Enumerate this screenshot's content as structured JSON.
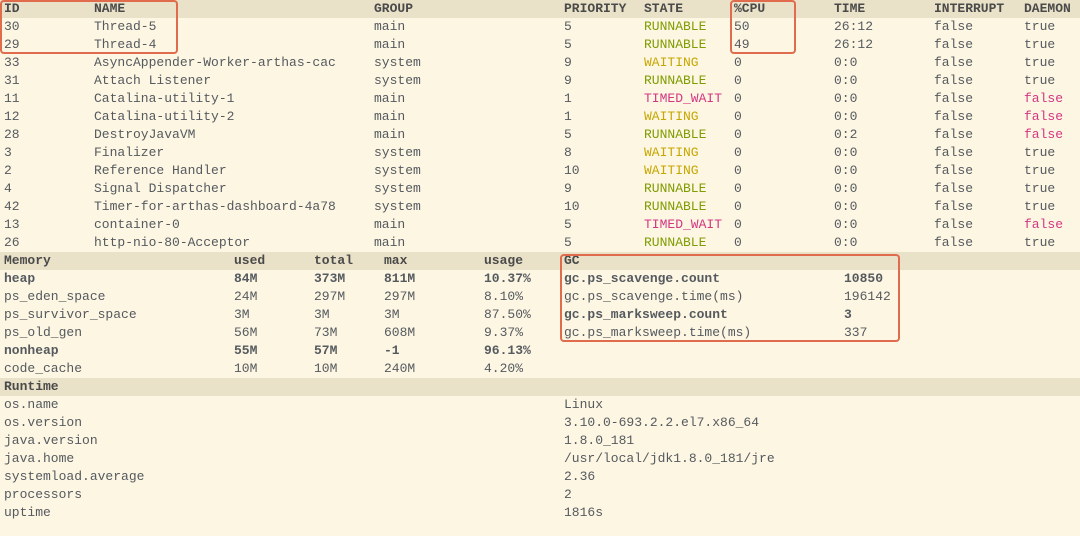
{
  "threads": {
    "headers": {
      "id": "ID",
      "name": "NAME",
      "group": "GROUP",
      "priority": "PRIORITY",
      "state": "STATE",
      "cpu": "%CPU",
      "time": "TIME",
      "interrupt": "INTERRUPT",
      "daemon": "DAEMON"
    },
    "rows": [
      {
        "id": "30",
        "name": "Thread-5",
        "group": "main",
        "priority": "5",
        "state": "RUNNABLE",
        "state_cls": "green",
        "cpu": "50",
        "time": "26:12",
        "interrupt": "false",
        "daemon": "true",
        "daemon_cls": ""
      },
      {
        "id": "29",
        "name": "Thread-4",
        "group": "main",
        "priority": "5",
        "state": "RUNNABLE",
        "state_cls": "green",
        "cpu": "49",
        "time": "26:12",
        "interrupt": "false",
        "daemon": "true",
        "daemon_cls": ""
      },
      {
        "id": "33",
        "name": "AsyncAppender-Worker-arthas-cac",
        "group": "system",
        "priority": "9",
        "state": "WAITING",
        "state_cls": "yellow",
        "cpu": "0",
        "time": "0:0",
        "interrupt": "false",
        "daemon": "true",
        "daemon_cls": ""
      },
      {
        "id": "31",
        "name": "Attach Listener",
        "group": "system",
        "priority": "9",
        "state": "RUNNABLE",
        "state_cls": "green",
        "cpu": "0",
        "time": "0:0",
        "interrupt": "false",
        "daemon": "true",
        "daemon_cls": ""
      },
      {
        "id": "11",
        "name": "Catalina-utility-1",
        "group": "main",
        "priority": "1",
        "state": "TIMED_WAIT",
        "state_cls": "pink",
        "cpu": "0",
        "time": "0:0",
        "interrupt": "false",
        "daemon": "false",
        "daemon_cls": "redf"
      },
      {
        "id": "12",
        "name": "Catalina-utility-2",
        "group": "main",
        "priority": "1",
        "state": "WAITING",
        "state_cls": "yellow",
        "cpu": "0",
        "time": "0:0",
        "interrupt": "false",
        "daemon": "false",
        "daemon_cls": "redf"
      },
      {
        "id": "28",
        "name": "DestroyJavaVM",
        "group": "main",
        "priority": "5",
        "state": "RUNNABLE",
        "state_cls": "green",
        "cpu": "0",
        "time": "0:2",
        "interrupt": "false",
        "daemon": "false",
        "daemon_cls": "redf"
      },
      {
        "id": "3",
        "name": "Finalizer",
        "group": "system",
        "priority": "8",
        "state": "WAITING",
        "state_cls": "yellow",
        "cpu": "0",
        "time": "0:0",
        "interrupt": "false",
        "daemon": "true",
        "daemon_cls": ""
      },
      {
        "id": "2",
        "name": "Reference Handler",
        "group": "system",
        "priority": "10",
        "state": "WAITING",
        "state_cls": "yellow",
        "cpu": "0",
        "time": "0:0",
        "interrupt": "false",
        "daemon": "true",
        "daemon_cls": ""
      },
      {
        "id": "4",
        "name": "Signal Dispatcher",
        "group": "system",
        "priority": "9",
        "state": "RUNNABLE",
        "state_cls": "green",
        "cpu": "0",
        "time": "0:0",
        "interrupt": "false",
        "daemon": "true",
        "daemon_cls": ""
      },
      {
        "id": "42",
        "name": "Timer-for-arthas-dashboard-4a78",
        "group": "system",
        "priority": "10",
        "state": "RUNNABLE",
        "state_cls": "green",
        "cpu": "0",
        "time": "0:0",
        "interrupt": "false",
        "daemon": "true",
        "daemon_cls": ""
      },
      {
        "id": "13",
        "name": "container-0",
        "group": "main",
        "priority": "5",
        "state": "TIMED_WAIT",
        "state_cls": "pink",
        "cpu": "0",
        "time": "0:0",
        "interrupt": "false",
        "daemon": "false",
        "daemon_cls": "redf"
      },
      {
        "id": "26",
        "name": "http-nio-80-Acceptor",
        "group": "main",
        "priority": "5",
        "state": "RUNNABLE",
        "state_cls": "green",
        "cpu": "0",
        "time": "0:0",
        "interrupt": "false",
        "daemon": "true",
        "daemon_cls": ""
      }
    ]
  },
  "memory": {
    "headers": {
      "name": "Memory",
      "used": "used",
      "total": "total",
      "max": "max",
      "usage": "usage",
      "gc": "GC"
    },
    "rows": [
      {
        "name": "heap",
        "used": "84M",
        "total": "373M",
        "max": "811M",
        "usage": "10.37%",
        "bold": true
      },
      {
        "name": "ps_eden_space",
        "used": "24M",
        "total": "297M",
        "max": "297M",
        "usage": "8.10%",
        "bold": false
      },
      {
        "name": "ps_survivor_space",
        "used": "3M",
        "total": "3M",
        "max": "3M",
        "usage": "87.50%",
        "bold": false
      },
      {
        "name": "ps_old_gen",
        "used": "56M",
        "total": "73M",
        "max": "608M",
        "usage": "9.37%",
        "bold": false
      },
      {
        "name": "nonheap",
        "used": "55M",
        "total": "57M",
        "max": "-1",
        "usage": "96.13%",
        "bold": true
      },
      {
        "name": "code_cache",
        "used": "10M",
        "total": "10M",
        "max": "240M",
        "usage": "4.20%",
        "bold": false
      }
    ],
    "gc": [
      {
        "k": "gc.ps_scavenge.count",
        "v": "10850",
        "bold": true
      },
      {
        "k": "gc.ps_scavenge.time(ms)",
        "v": "196142",
        "bold": false
      },
      {
        "k": "gc.ps_marksweep.count",
        "v": "3",
        "bold": true
      },
      {
        "k": "gc.ps_marksweep.time(ms)",
        "v": "337",
        "bold": false
      }
    ]
  },
  "runtime": {
    "header": "Runtime",
    "rows": [
      {
        "k": "os.name",
        "v": "Linux"
      },
      {
        "k": "os.version",
        "v": "3.10.0-693.2.2.el7.x86_64"
      },
      {
        "k": "java.version",
        "v": "1.8.0_181"
      },
      {
        "k": "java.home",
        "v": "/usr/local/jdk1.8.0_181/jre"
      },
      {
        "k": "systemload.average",
        "v": "2.36"
      },
      {
        "k": "processors",
        "v": "2"
      },
      {
        "k": "uptime",
        "v": "1816s"
      }
    ]
  }
}
